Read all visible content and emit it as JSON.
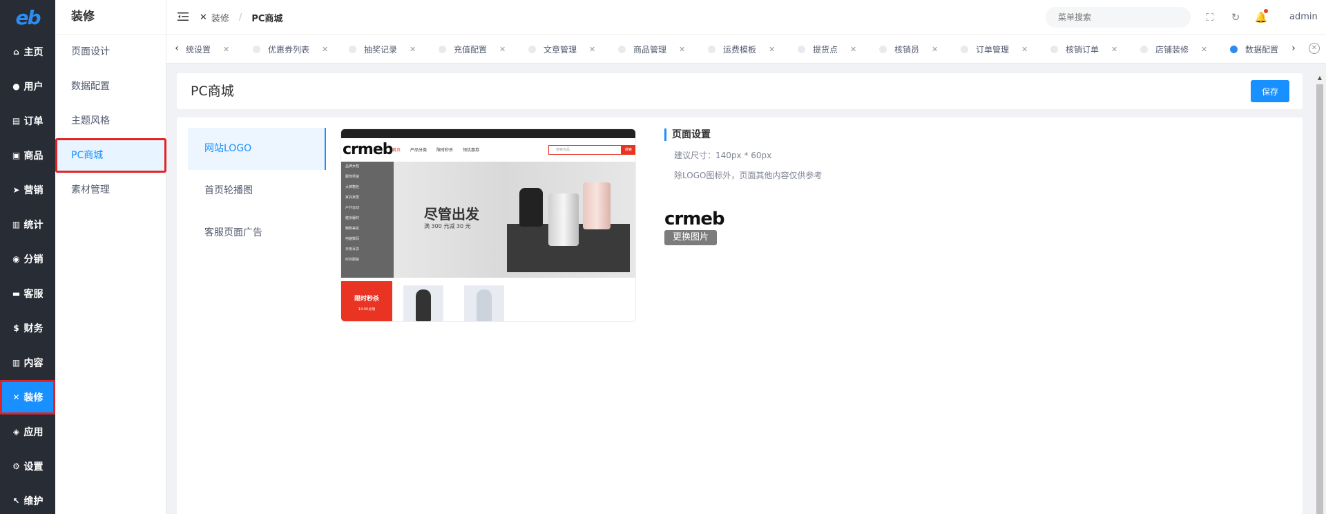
{
  "rail": {
    "logo": "eb",
    "items": [
      {
        "label": "主页",
        "icon": "home-icon",
        "glyph": "⌂"
      },
      {
        "label": "用户",
        "icon": "user-icon",
        "glyph": "●"
      },
      {
        "label": "订单",
        "icon": "cart-icon",
        "glyph": "▤"
      },
      {
        "label": "商品",
        "icon": "shop-icon",
        "glyph": "▣"
      },
      {
        "label": "营销",
        "icon": "send-icon",
        "glyph": "➤"
      },
      {
        "label": "统计",
        "icon": "chart-icon",
        "glyph": "▥"
      },
      {
        "label": "分销",
        "icon": "share-icon",
        "glyph": "◉"
      },
      {
        "label": "客服",
        "icon": "chat-icon",
        "glyph": "▬"
      },
      {
        "label": "财务",
        "icon": "dollar-icon",
        "glyph": "$"
      },
      {
        "label": "内容",
        "icon": "book-icon",
        "glyph": "▥"
      },
      {
        "label": "装修",
        "icon": "tools-icon",
        "glyph": "✕",
        "active": true
      },
      {
        "label": "应用",
        "icon": "cube-icon",
        "glyph": "◈"
      },
      {
        "label": "设置",
        "icon": "gear-icon",
        "glyph": "⚙"
      },
      {
        "label": "维护",
        "icon": "wrench-icon",
        "glyph": "↖"
      }
    ]
  },
  "submenu": {
    "title": "装修",
    "items": [
      {
        "label": "页面设计"
      },
      {
        "label": "数据配置"
      },
      {
        "label": "主题风格"
      },
      {
        "label": "PC商城",
        "active": true
      },
      {
        "label": "素材管理"
      }
    ]
  },
  "header": {
    "breadcrumb_parent": "装修",
    "breadcrumb_sep": "/",
    "breadcrumb_current": "PC商城",
    "search_placeholder": "菜单搜索",
    "user": "admin"
  },
  "tabs": [
    {
      "label": "统设置",
      "partial": true
    },
    {
      "label": "优惠券列表"
    },
    {
      "label": "抽奖记录"
    },
    {
      "label": "充值配置"
    },
    {
      "label": "文章管理"
    },
    {
      "label": "商品管理"
    },
    {
      "label": "运费模板"
    },
    {
      "label": "提货点"
    },
    {
      "label": "核销员"
    },
    {
      "label": "订单管理"
    },
    {
      "label": "核销订单"
    },
    {
      "label": "店铺装修"
    },
    {
      "label": "数据配置",
      "active": true
    }
  ],
  "page": {
    "title": "PC商城",
    "save_label": "保存",
    "nav": [
      {
        "label": "网站LOGO",
        "active": true
      },
      {
        "label": "首页轮播图"
      },
      {
        "label": "客服页面广告"
      }
    ]
  },
  "preview": {
    "logo": "crmeb",
    "links": [
      "首页",
      "产品分类",
      "限时秒杀",
      "领优惠券"
    ],
    "search_placeholder": "搜索商品",
    "search_btn": "搜索",
    "categories": [
      "品牌女鞋",
      "服饰男装",
      "大牌箱包",
      "家具家居",
      "户外运动",
      "健身器材",
      "精致美妆",
      "电脑数码",
      "日用百货",
      "时尚服装"
    ],
    "slogan": "尽管出发",
    "slogan_sub": "满 300 元减 30 元",
    "flash_title": "限时秒杀",
    "flash_time": "14:00点场"
  },
  "settings": {
    "title": "页面设置",
    "size_hint": "建议尺寸：140px * 60px",
    "note": "除LOGO图标外，页面其他内容仅供参考",
    "logo_text": "crmeb",
    "change_btn": "更换图片"
  },
  "colors": {
    "primary": "#1890ff",
    "rail_bg": "#282c35",
    "highlight": "#e02424",
    "brand_red": "#e93323"
  }
}
